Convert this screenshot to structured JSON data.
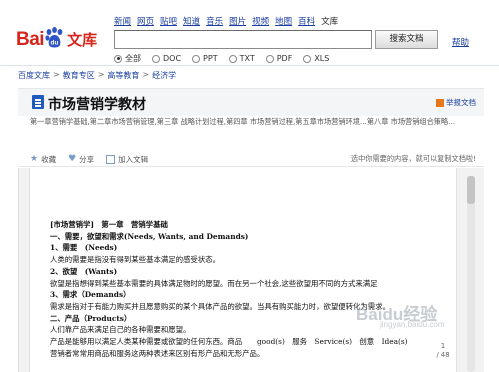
{
  "logo": {
    "text_bai": "Bai",
    "text_du": "du",
    "text_wenku": "文库"
  },
  "nav": {
    "items": [
      "新闻",
      "网页",
      "贴吧",
      "知道",
      "音乐",
      "图片",
      "视频",
      "地图",
      "百科"
    ],
    "current": "文库"
  },
  "search": {
    "value": "",
    "button_label": "搜索文档",
    "help_label": "帮助"
  },
  "filters": {
    "options": [
      "全部",
      "DOC",
      "PPT",
      "TXT",
      "PDF",
      "XLS"
    ],
    "selected": "全部"
  },
  "breadcrumb": [
    "百度文库",
    "教育专区",
    "高等教育",
    "经济学"
  ],
  "document": {
    "title": "市场营销学教材",
    "report_label": "举报文档",
    "summary": "第一章营销学基础,第二章市场营销管理,第三章 战略计划过程,第四章 市场营销过程,第五章市场营销环境...第八章 市场营销组合策略..."
  },
  "toolbar": {
    "favorite": "收藏",
    "share": "分享",
    "add": "加入文辑",
    "hint": "选中你需要的内容，就可以复制文档啦!"
  },
  "page": {
    "lines": [
      {
        "text": "[市场营销学]　第一章　营销学基础",
        "style": "h1"
      },
      {
        "text": "一、需要，欲望和需求(Needs, Wants, and Demands)",
        "style": "h2"
      },
      {
        "text": "1、需要　(Needs)",
        "style": "h2"
      },
      {
        "text": "人类的需要是指没有得到某些基本满足的感受状态。",
        "style": ""
      },
      {
        "text": "2、欲望　(Wants)",
        "style": "h2"
      },
      {
        "text": "欲望是指想得到某些基本需要的具体满足物时的愿望。而在另一个社会,这些欲望用不同的方式来满足",
        "style": ""
      },
      {
        "text": "3、需求（Demands）",
        "style": "h2"
      },
      {
        "text": "需求是指对于有能力购买并且愿意购买的某个具体产品的欲望。当具有购买能力时，欲望便转化为需求。",
        "style": ""
      },
      {
        "text": "二、产品（Products）",
        "style": "h2"
      },
      {
        "text": "人们靠产品来满足自己的各种需要和愿望。",
        "style": ""
      },
      {
        "text": "产品是能够用以满足人类某种需要或欲望的任何东西。商品　　good(s)　服务　Service(s)　创意　Idea(s)",
        "style": ""
      },
      {
        "text": "营销者常常用商品和服务这两种表述来区别有形产品和无形产品。",
        "style": ""
      }
    ],
    "counter_current": "1",
    "counter_total": "/ 48"
  },
  "watermark": {
    "main": "Baidu经验",
    "sub": "jingyan.baidu.com"
  },
  "colors": {
    "brand_red": "#d6251a",
    "link_blue": "#1b3fa0",
    "doc_icon_blue": "#1e5bbf"
  }
}
